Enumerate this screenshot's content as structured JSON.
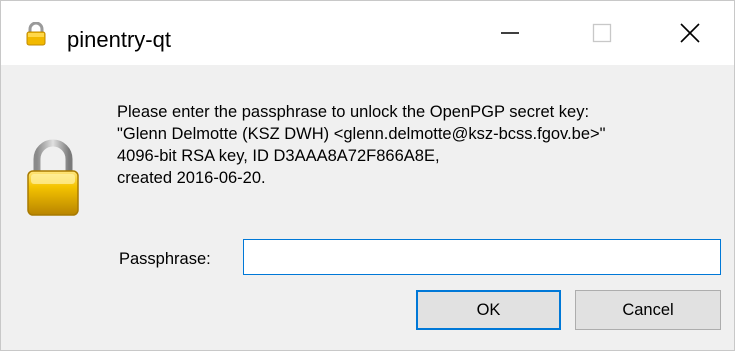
{
  "window": {
    "title": "pinentry-qt"
  },
  "dialog": {
    "message_lines": [
      "Please enter the passphrase to unlock the OpenPGP secret key:",
      "\"Glenn Delmotte (KSZ DWH) <glenn.delmotte@ksz-bcss.fgov.be>\"",
      "4096-bit RSA key, ID D3AAA8A72F866A8E,",
      "created 2016-06-20."
    ],
    "passphrase_label": "Passphrase:",
    "passphrase_value": "",
    "ok_label": "OK",
    "cancel_label": "Cancel"
  },
  "icons": {
    "title_icon": "lock-icon",
    "dialog_icon": "padlock-icon",
    "minimize": "minimize-icon",
    "maximize": "maximize-icon",
    "close": "close-icon"
  },
  "colors": {
    "accent": "#0078d7",
    "window_bg": "#f0f0f0",
    "titlebar_bg": "#ffffff",
    "lock_gold": "#e8b400"
  }
}
